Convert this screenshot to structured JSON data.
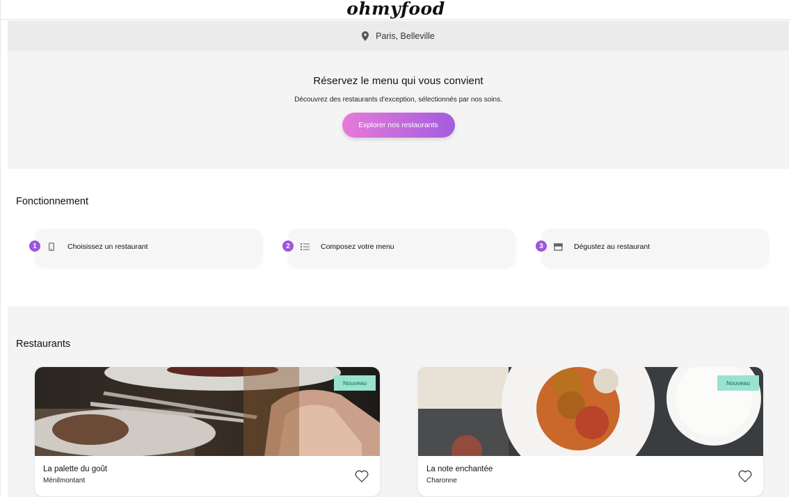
{
  "header": {
    "logo": "ohmyfood"
  },
  "location": {
    "icon": "map-pin-icon",
    "text": "Paris, Belleville"
  },
  "hero": {
    "title": "Réservez le menu qui vous convient",
    "subtitle": "Découvrez des restaurants d'exception, sélectionnés par nos soins.",
    "cta_label": "Explorer nos restaurants"
  },
  "how_it_works": {
    "title": "Fonctionnement",
    "steps": [
      {
        "number": "1",
        "icon": "smartphone-icon",
        "label": "Choisissez un restaurant"
      },
      {
        "number": "2",
        "icon": "list-icon",
        "label": "Composez votre menu"
      },
      {
        "number": "3",
        "icon": "storefront-icon",
        "label": "Dégustez au restaurant"
      }
    ]
  },
  "restaurants": {
    "title": "Restaurants",
    "items": [
      {
        "name": "La palette du goût",
        "area": "Ménilmontant",
        "badge": "Nouveau",
        "icon": "heart-icon"
      },
      {
        "name": "La note enchantée",
        "area": "Charonne",
        "badge": "Nouveau",
        "icon": "heart-icon"
      }
    ]
  },
  "colors": {
    "accent_start": "#e77ad8",
    "accent_end": "#a35cdf",
    "step_number": "#9c56d9",
    "badge_bg": "#99e2d0"
  }
}
